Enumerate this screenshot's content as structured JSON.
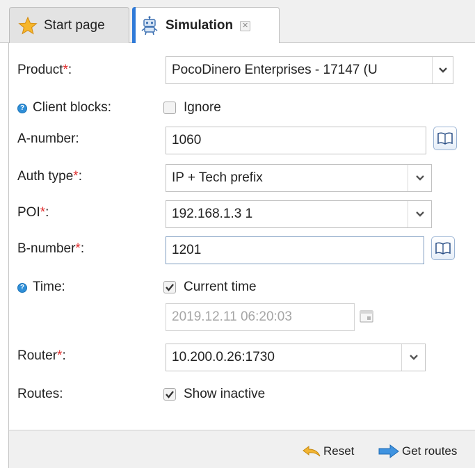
{
  "tabs": {
    "start": {
      "label": "Start page",
      "icon": "star-icon"
    },
    "simulation": {
      "label": "Simulation",
      "icon": "robot-icon",
      "close_symbol": "✕"
    }
  },
  "form": {
    "product": {
      "label": "Product",
      "required_mark": "*",
      "colon": ":",
      "value": "PocoDinero Enterprises - 17147 (U"
    },
    "client_blocks": {
      "label": "Client blocks:",
      "checkbox_label": "Ignore",
      "checked": false
    },
    "a_number": {
      "label": "A-number:",
      "value": "1060"
    },
    "auth_type": {
      "label": "Auth type",
      "required_mark": "*",
      "colon": ":",
      "value": "IP + Tech prefix"
    },
    "poi": {
      "label": "POI",
      "required_mark": "*",
      "colon": ":",
      "value": "192.168.1.3 1"
    },
    "b_number": {
      "label": "B-number",
      "required_mark": "*",
      "colon": ":",
      "value": "1201"
    },
    "time": {
      "label": "Time:",
      "checkbox_label": "Current time",
      "checked": true,
      "datetime_value": "2019.12.11 06:20:03"
    },
    "router": {
      "label": "Router",
      "required_mark": "*",
      "colon": ":",
      "value": "10.200.0.26:1730"
    },
    "routes": {
      "label": "Routes:",
      "checkbox_label": "Show inactive",
      "checked": true
    }
  },
  "toolbar": {
    "reset_label": "Reset",
    "get_routes_label": "Get routes"
  },
  "colors": {
    "required": "#e02a2a",
    "accent": "#2f7ad8",
    "help_icon": "#2f8fd8"
  }
}
